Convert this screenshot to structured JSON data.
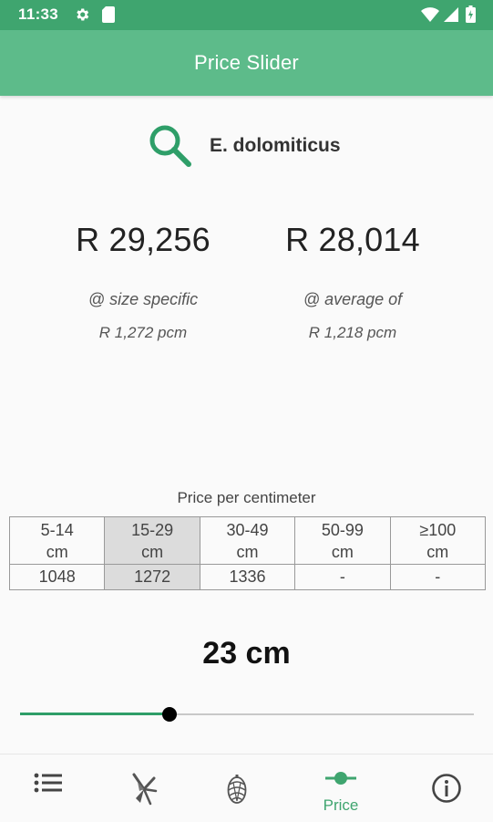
{
  "status_bar": {
    "time": "11:33",
    "icons": [
      "gear-icon",
      "sd-card-icon",
      "wifi-icon",
      "signal-icon",
      "battery-icon"
    ]
  },
  "app_bar": {
    "title": "Price Slider"
  },
  "search": {
    "species": "E. dolomiticus",
    "icon": "search-icon",
    "icon_color": "#2e9e68"
  },
  "prices": {
    "specific": {
      "amount": "R 29,256",
      "caption": "@ size specific",
      "pcm": "R 1,272 pcm"
    },
    "average": {
      "amount": "R 28,014",
      "caption": "@ average of",
      "pcm": "R 1,218 pcm"
    }
  },
  "price_table": {
    "caption": "Price per centimeter",
    "columns": [
      {
        "range": "5-14",
        "unit": "cm",
        "value": "1048",
        "selected": false
      },
      {
        "range": "15-29",
        "unit": "cm",
        "value": "1272",
        "selected": true
      },
      {
        "range": "30-49",
        "unit": "cm",
        "value": "1336",
        "selected": false
      },
      {
        "range": "50-99",
        "unit": "cm",
        "value": "-",
        "selected": false
      },
      {
        "range": "≥100",
        "unit": "cm",
        "value": "-",
        "selected": false
      }
    ]
  },
  "size": {
    "label": "23 cm",
    "slider_fraction": 0.33
  },
  "bottom_nav": {
    "items": [
      {
        "name": "list-icon",
        "label": ""
      },
      {
        "name": "plant-icon",
        "label": ""
      },
      {
        "name": "cone-icon",
        "label": ""
      },
      {
        "name": "slider-icon",
        "label": "Price",
        "active": true
      },
      {
        "name": "info-icon",
        "label": ""
      }
    ]
  },
  "colors": {
    "accent": "#3fa56f",
    "app_bar": "#5dbb8a",
    "slider": "#2e9e68"
  }
}
